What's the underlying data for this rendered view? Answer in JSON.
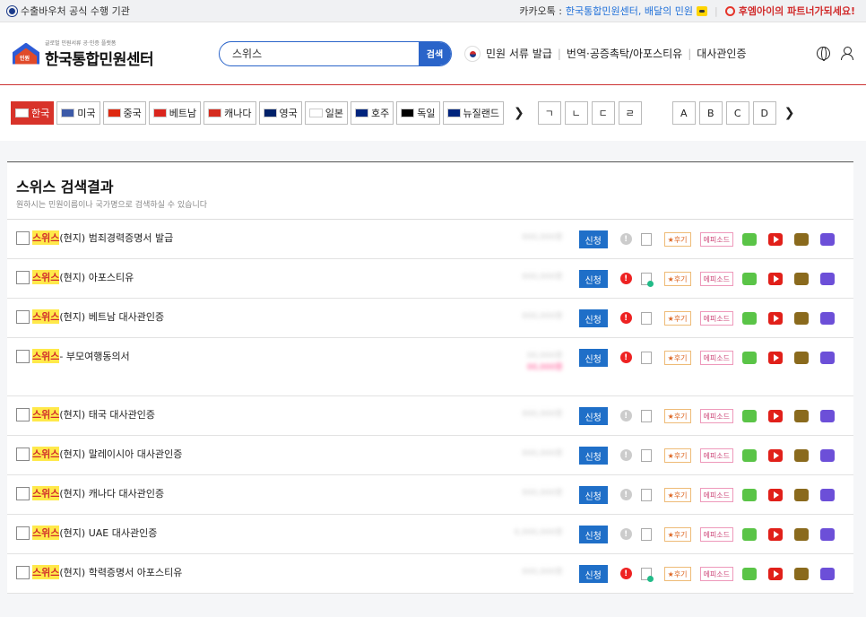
{
  "topbar": {
    "left_text": "수출바우처 공식 수행 기관",
    "kakao_prefix": "카카오톡 :",
    "kakao_link": "한국통합민원센터, 배달의 민원",
    "partner": "후엠아이의 파트너가되세요!"
  },
  "header": {
    "logo_sub": "글로벌 민원서류 공·인증 플랫폼",
    "logo_title": "한국통합민원센터",
    "logo_badge": "민원",
    "search_value": "스위스",
    "search_btn": "검색",
    "nav": [
      "민원 서류 발급",
      "번역·공증촉탁/아포스티유",
      "대사관인증"
    ]
  },
  "countries": [
    {
      "name": "한국",
      "flag": "#ffffff"
    },
    {
      "name": "미국",
      "flag": "#3c5aa8"
    },
    {
      "name": "중국",
      "flag": "#de2910"
    },
    {
      "name": "베트남",
      "flag": "#da251d"
    },
    {
      "name": "캐나다",
      "flag": "#d52b1e"
    },
    {
      "name": "영국",
      "flag": "#012169"
    },
    {
      "name": "일본",
      "flag": "#ffffff"
    },
    {
      "name": "호주",
      "flag": "#00247d"
    },
    {
      "name": "독일",
      "flag": "#000000"
    },
    {
      "name": "뉴질랜드",
      "flag": "#00247d"
    }
  ],
  "letters": [
    "ㄱ",
    "ㄴ",
    "ㄷ",
    "ㄹ",
    "A",
    "B",
    "C",
    "D"
  ],
  "results": {
    "title": "스위스 검색결과",
    "subtitle": "원하시는 민원이름이나 국가명으로 검색하실 수 있습니다",
    "apply_label": "신청",
    "review_label": "★후기",
    "episode_label": "에피소드",
    "items": [
      {
        "hl": "스위스",
        "rest": "(현지) 범죄경력증명서 발급",
        "warn": "grey",
        "doc": "grey",
        "price": "000,000원"
      },
      {
        "hl": "스위스",
        "rest": "(현지) 아포스티유",
        "warn": "red",
        "doc": "green",
        "price": "000,000원"
      },
      {
        "hl": "스위스",
        "rest": "(현지) 베트남 대사관인증",
        "warn": "red",
        "doc": "grey",
        "price": "000,000원"
      },
      {
        "hl": "스위스",
        "rest": " - 부모여행동의서",
        "warn": "red",
        "doc": "grey",
        "price": "00,000원",
        "price2": "00,000원",
        "tall": true
      },
      {
        "hl": "스위스",
        "rest": "(현지) 태국 대사관인증",
        "warn": "grey",
        "doc": "grey",
        "price": "000,000원"
      },
      {
        "hl": "스위스",
        "rest": "(현지) 말레이시아 대사관인증",
        "warn": "grey",
        "doc": "grey",
        "price": "000,000원"
      },
      {
        "hl": "스위스",
        "rest": "(현지) 캐나다 대사관인증",
        "warn": "grey",
        "doc": "grey",
        "price": "000,000원"
      },
      {
        "hl": "스위스",
        "rest": "(현지) UAE 대사관인증",
        "warn": "grey",
        "doc": "grey",
        "price": "0,000,000원"
      },
      {
        "hl": "스위스",
        "rest": "(현지) 학력증명서 아포스티유",
        "warn": "red",
        "doc": "green",
        "price": "000,000원"
      }
    ]
  }
}
